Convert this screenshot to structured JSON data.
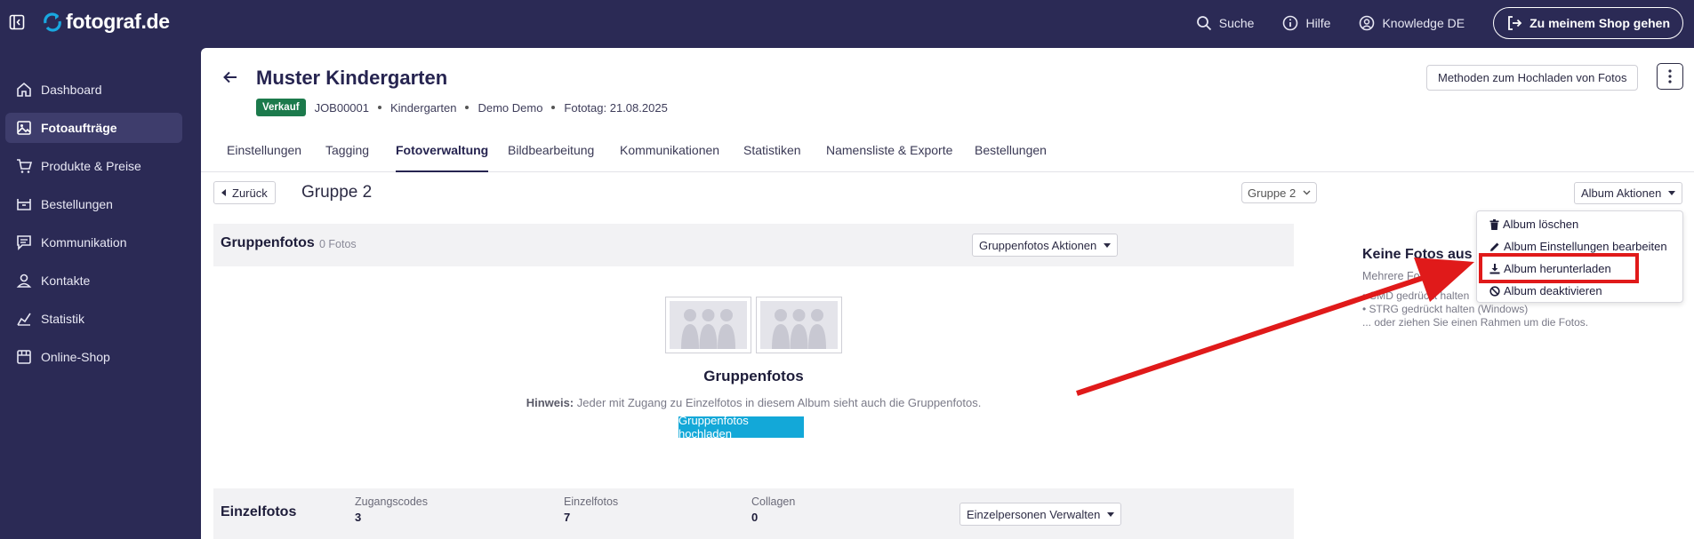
{
  "brand": {
    "logo_text": "fotograf.de"
  },
  "header": {
    "links": [
      {
        "label": "Suche",
        "icon": "search-icon"
      },
      {
        "label": "Hilfe",
        "icon": "info-icon"
      },
      {
        "label": "Knowledge DE",
        "icon": "user-circle-icon"
      }
    ],
    "shop_button": "Zu meinem Shop gehen"
  },
  "sidebar": {
    "items": [
      {
        "label": "Dashboard",
        "icon": "home-icon"
      },
      {
        "label": "Fotoaufträge",
        "icon": "image-icon",
        "active": true
      },
      {
        "label": "Produkte & Preise",
        "icon": "cart-icon"
      },
      {
        "label": "Bestellungen",
        "icon": "box-icon"
      },
      {
        "label": "Kommunikation",
        "icon": "message-icon"
      },
      {
        "label": "Kontakte",
        "icon": "person-icon"
      },
      {
        "label": "Statistik",
        "icon": "chart-icon"
      },
      {
        "label": "Online-Shop",
        "icon": "store-icon"
      }
    ]
  },
  "job": {
    "title": "Muster Kindergarten",
    "status_badge": "Verkauf",
    "job_id": "JOB00001",
    "type": "Kindergarten",
    "client": "Demo Demo",
    "shoot_date": "Fototag: 21.08.2025",
    "upload_methods_button": "Methoden zum Hochladen von Fotos"
  },
  "tabs": [
    {
      "label": "Einstellungen"
    },
    {
      "label": "Tagging"
    },
    {
      "label": "Fotoverwaltung",
      "active": true
    },
    {
      "label": "Bildbearbeitung"
    },
    {
      "label": "Kommunikationen"
    },
    {
      "label": "Statistiken"
    },
    {
      "label": "Namensliste & Exporte"
    },
    {
      "label": "Bestellungen"
    }
  ],
  "album": {
    "back_button": "Zurück",
    "group_title": "Gruppe 2",
    "group_select_value": "Gruppe 2",
    "actions_button": "Album Aktionen",
    "actions_menu": [
      {
        "label": "Album löschen",
        "icon": "trash-icon"
      },
      {
        "label": "Album Einstellungen bearbeiten",
        "icon": "pencil-icon"
      },
      {
        "label": "Album herunterladen",
        "icon": "download-icon",
        "highlighted": true
      },
      {
        "label": "Album deaktivieren",
        "icon": "ban-icon"
      }
    ]
  },
  "group_photos": {
    "section_title": "Gruppenfotos",
    "count": "0 Fotos",
    "actions_button": "Gruppenfotos Aktionen",
    "empty_title": "Gruppenfotos",
    "hint_label": "Hinweis:",
    "hint_text": "Jeder mit Zugang zu Einzelfotos in diesem Album sieht auch die Gruppenfotos.",
    "upload_button": "Gruppenfotos hochladen"
  },
  "single_photos": {
    "section_title": "Einzelfotos",
    "stats": [
      {
        "label": "Zugangscodes",
        "value": "3"
      },
      {
        "label": "Einzelfotos",
        "value": "7"
      },
      {
        "label": "Collagen",
        "value": "0"
      }
    ],
    "manage_button": "Einzelpersonen Verwalten"
  },
  "selection_panel": {
    "title": "Keine Fotos aus",
    "subtitle": "Mehrere Fotos",
    "tips": [
      "• CMD gedrückt halten",
      "• STRG gedrückt halten (Windows)",
      "... oder ziehen Sie einen Rahmen um die Fotos."
    ]
  },
  "colors": {
    "sidebar_bg": "#2b2a55",
    "badge": "#1c7a4c",
    "cta": "#13a8d8",
    "annotation": "#e01a1a"
  }
}
